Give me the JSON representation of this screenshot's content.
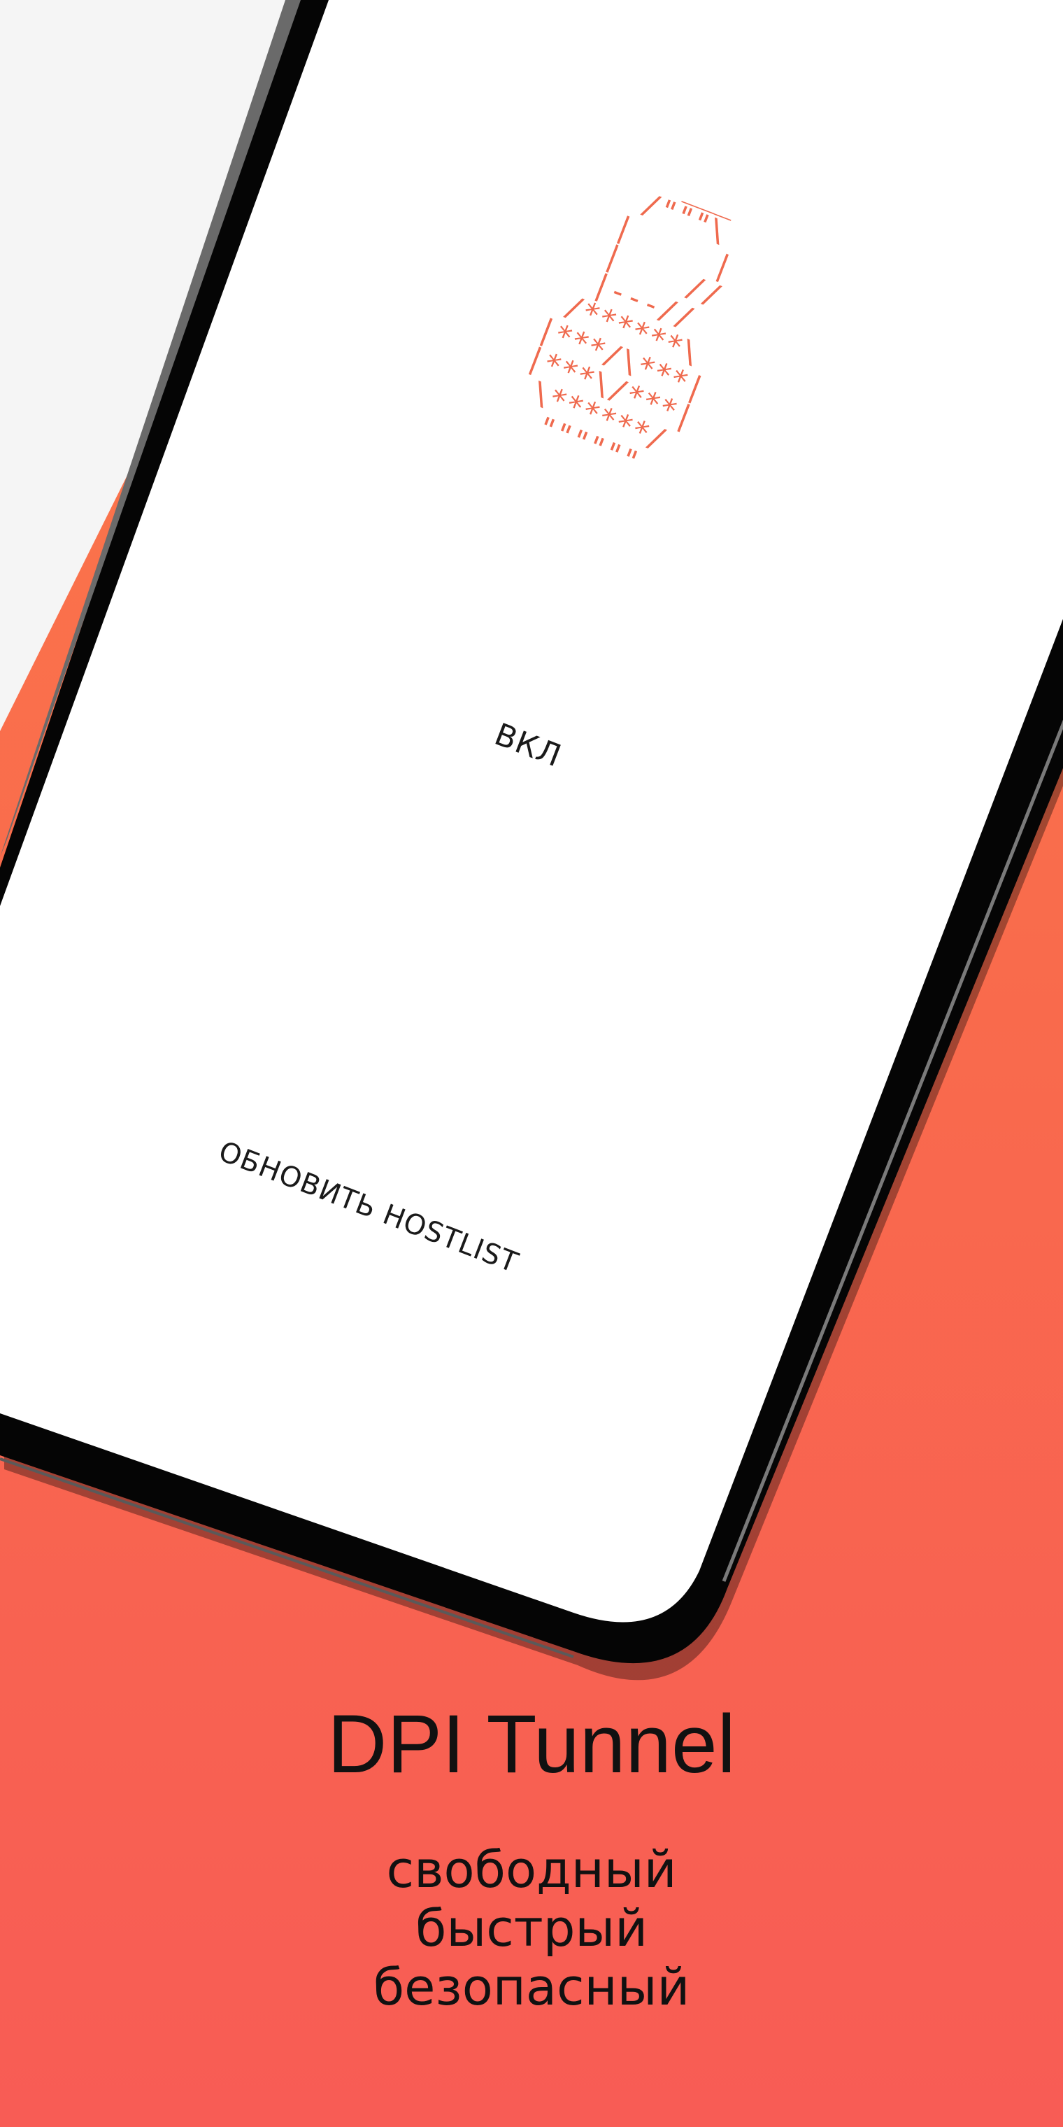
{
  "screen": {
    "toggle_label": "ВКЛ",
    "update_button_label": "ОБНОВИТЬ HOSTLIST",
    "lock_icon": "padlock-ascii-icon"
  },
  "promo": {
    "title": "DPI Tunnel",
    "taglines": [
      "свободный",
      "быстрый",
      "безопасный"
    ]
  },
  "colors": {
    "gradient_top": "#fb7a4a",
    "gradient_bottom": "#f85c55",
    "accent": "#ef6a4e",
    "screen": "#ffffff",
    "bezel": "#000000"
  }
}
